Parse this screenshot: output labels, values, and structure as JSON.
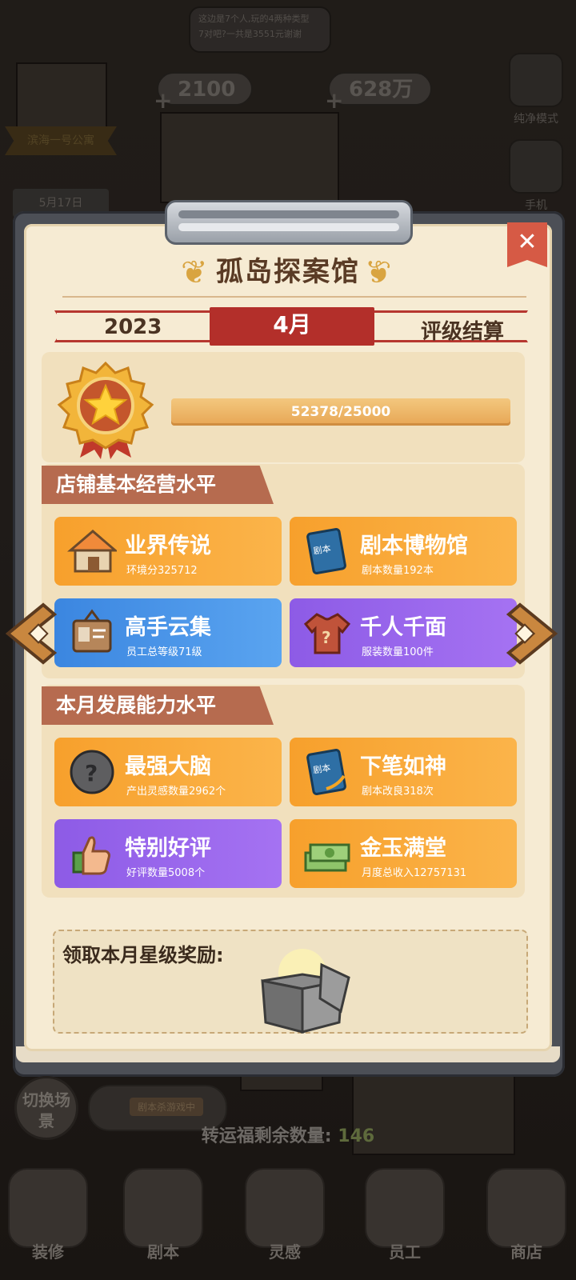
{
  "background": {
    "bubble_line1": "这边是7个人,玩的4两种类型",
    "bubble_line2": "7对吧?一共是3551元谢谢",
    "resource_gems": "2100",
    "resource_money": "628万",
    "side_pure_mode": "纯净模式",
    "side_phone": "手机",
    "apartment_tag": "滨海一号公寓",
    "date_card": "5月17日",
    "scene_button": "切换场景",
    "script_tag": "剧本杀游戏中",
    "fortune_label": "转运福剩余数量:",
    "fortune_count": "146",
    "nav": [
      {
        "label": "装修",
        "icon": "decorate-icon"
      },
      {
        "label": "剧本",
        "icon": "script-icon"
      },
      {
        "label": "灵感",
        "icon": "inspiration-icon"
      },
      {
        "label": "员工",
        "icon": "staff-icon"
      },
      {
        "label": "商店",
        "icon": "shop-icon"
      }
    ]
  },
  "modal": {
    "title": "孤岛探案馆",
    "year": "2023",
    "month": "4月",
    "subtitle": "评级结算",
    "progress_text": "52378/25000",
    "progress_fraction": 1.0,
    "close_label": "✕",
    "section1": {
      "heading": "店铺基本经营水平",
      "cards": [
        {
          "name": "业界传说",
          "sub": "环境分325712",
          "color": "orange",
          "icon": "house-icon"
        },
        {
          "name": "剧本博物馆",
          "sub": "剧本数量192本",
          "color": "orange",
          "icon": "book-icon"
        },
        {
          "name": "高手云集",
          "sub": "员工总等级71级",
          "color": "blue",
          "icon": "badge-icon"
        },
        {
          "name": "千人千面",
          "sub": "服装数量100件",
          "color": "purple",
          "icon": "shirt-icon"
        }
      ]
    },
    "section2": {
      "heading": "本月发展能力水平",
      "cards": [
        {
          "name": "最强大脑",
          "sub": "产出灵感数量2962个",
          "color": "orange",
          "icon": "brain-ball-icon"
        },
        {
          "name": "下笔如神",
          "sub": "剧本改良318次",
          "color": "orange",
          "icon": "script-pen-icon"
        },
        {
          "name": "特别好评",
          "sub": "好评数量5008个",
          "color": "purple",
          "icon": "thumbs-up-icon"
        },
        {
          "name": "金玉满堂",
          "sub": "月度总收入12757131",
          "color": "orange",
          "icon": "money-stack-icon"
        }
      ]
    },
    "reward_label": "领取本月星级奖励:",
    "book_icon_text": "剧本"
  },
  "colors": {
    "ribbon_red": "#b32f2a",
    "card_orange": "#f7a02c",
    "card_blue": "#3b86e0",
    "card_purple": "#8d5be6",
    "section_head": "#b66b4f"
  }
}
